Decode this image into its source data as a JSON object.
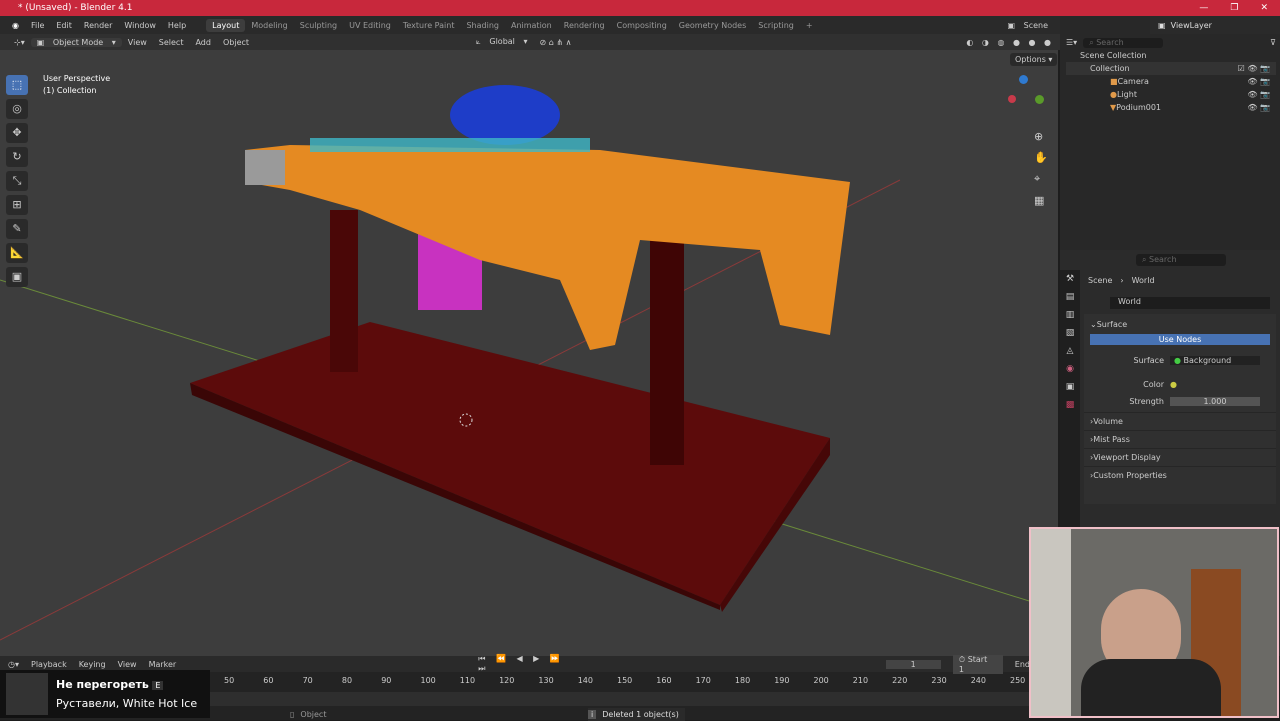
{
  "title": "* (Unsaved) - Blender 4.1",
  "menu": [
    "File",
    "Edit",
    "Render",
    "Window",
    "Help"
  ],
  "workspaces": [
    "Layout",
    "Modeling",
    "Sculpting",
    "UV Editing",
    "Texture Paint",
    "Shading",
    "Animation",
    "Rendering",
    "Compositing",
    "Geometry Nodes",
    "Scripting",
    "+"
  ],
  "scene": "Scene",
  "view_layer": "ViewLayer",
  "viewport_header": {
    "mode": "Object Mode",
    "menus": [
      "View",
      "Select",
      "Add",
      "Object"
    ],
    "orientation": "Global",
    "options": "Options"
  },
  "overlay": {
    "perspective": "User Perspective",
    "collection": "(1) Collection"
  },
  "outliner": {
    "search": "Search",
    "scene_collection": "Scene Collection",
    "collection": "Collection",
    "items": [
      "Camera",
      "Light",
      "Podium001"
    ]
  },
  "properties": {
    "search": "Search",
    "breadcrumb_scene": "Scene",
    "breadcrumb_world": "World",
    "world_name": "World",
    "surface_panel": "Surface",
    "use_nodes": "Use Nodes",
    "surface_label": "Surface",
    "surface_value": "Background",
    "color_label": "Color",
    "strength_label": "Strength",
    "strength_value": "1.000",
    "panels": [
      "Volume",
      "Mist Pass",
      "Viewport Display",
      "Custom Properties"
    ]
  },
  "timeline": {
    "menus": [
      "Playback",
      "Keying",
      "View",
      "Marker"
    ],
    "current_frame": "1",
    "start_label": "Start",
    "start_value": "1",
    "end_label": "End",
    "ticks": [
      "50",
      "60",
      "70",
      "80",
      "90",
      "100",
      "110",
      "120",
      "130",
      "140",
      "150",
      "160",
      "170",
      "180",
      "190",
      "200",
      "210",
      "220",
      "230",
      "240",
      "250"
    ]
  },
  "status": {
    "mode": "Object",
    "message": "Deleted 1 object(s)"
  },
  "now_playing": {
    "track": "Не перегореть",
    "badge": "E",
    "artist": "Руставели, White Hot Ice"
  }
}
